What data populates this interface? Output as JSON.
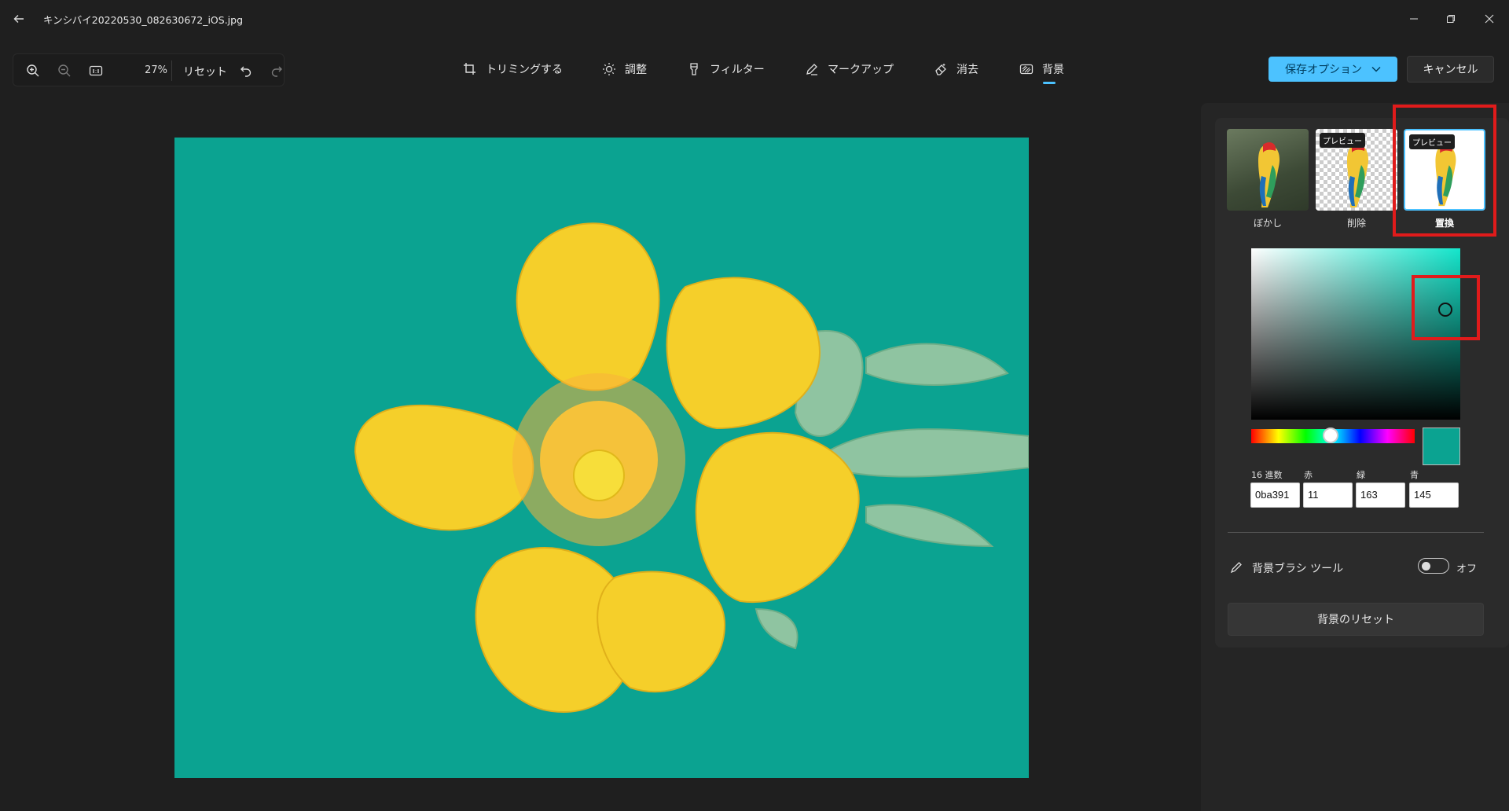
{
  "window": {
    "title": "キンシバイ20220530_082630672_iOS.jpg"
  },
  "toolbar": {
    "zoom": "27%",
    "reset_label": "リセット",
    "tabs": [
      {
        "label": "トリミングする",
        "icon": "crop-icon"
      },
      {
        "label": "調整",
        "icon": "brightness-icon"
      },
      {
        "label": "フィルター",
        "icon": "filter-icon"
      },
      {
        "label": "マークアップ",
        "icon": "markup-pen-icon"
      },
      {
        "label": "消去",
        "icon": "erase-icon"
      },
      {
        "label": "背景",
        "icon": "background-icon",
        "active": true
      }
    ],
    "save_label": "保存オプション",
    "cancel_label": "キャンセル"
  },
  "panel": {
    "thumbnails": [
      {
        "label": "ぼかし",
        "tag": ""
      },
      {
        "label": "削除",
        "tag": "プレビュー"
      },
      {
        "label": "置換",
        "tag": "プレビュー",
        "selected": true
      }
    ],
    "color": {
      "hex_label": "16 進数",
      "red_label": "赤",
      "green_label": "緑",
      "blue_label": "青",
      "hex": "0ba391",
      "red": "11",
      "green": "163",
      "blue": "145",
      "swatch": "#0ba391"
    },
    "brush_tool_label": "背景ブラシ ツール",
    "brush_toggle_state": "オフ",
    "reset_background_label": "背景のリセット"
  },
  "colors": {
    "accent": "#4cc2ff",
    "canvas_background": "#0ba391",
    "highlight": "#e01b1b"
  }
}
